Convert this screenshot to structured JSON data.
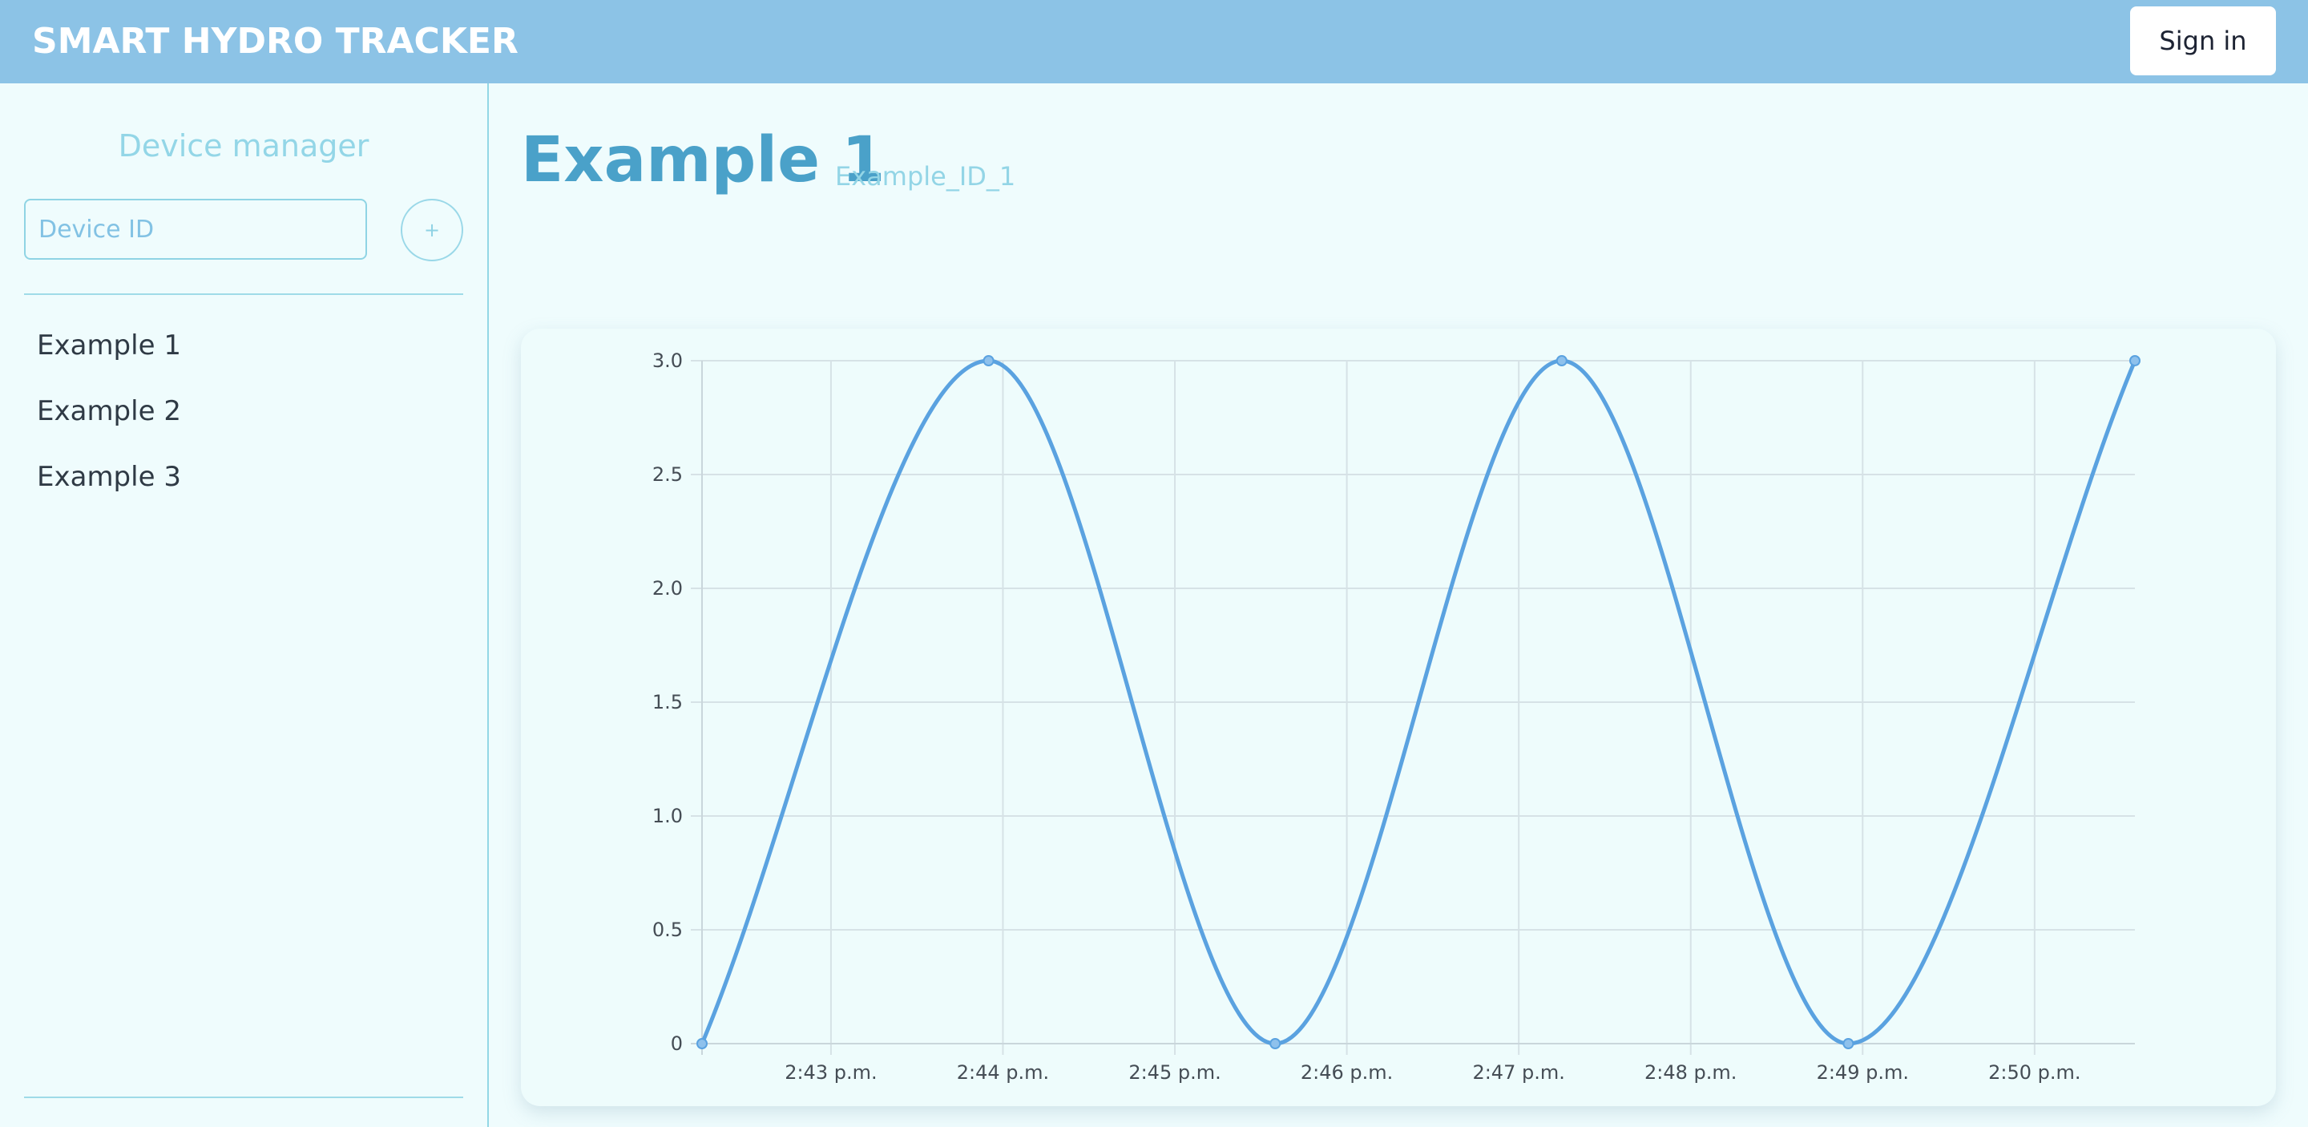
{
  "header": {
    "brand": "SMART HYDRO TRACKER",
    "signin_label": "Sign in",
    "background": "#8cc3e6"
  },
  "sidebar": {
    "title": "Device manager",
    "device_input_placeholder": "Device ID",
    "add_label": "+",
    "devices": [
      "Example 1",
      "Example 2",
      "Example 3"
    ]
  },
  "main": {
    "title": "Example 1",
    "device_id": "Example_ID_1"
  },
  "chart_data": {
    "type": "line",
    "xlabel": "",
    "ylabel": "",
    "ylim": [
      0,
      3
    ],
    "xlim": [
      "2:42:15 p.m.",
      "2:50:35 p.m."
    ],
    "y_ticks": [
      "0",
      "0.5",
      "1.0",
      "1.5",
      "2.0",
      "2.5",
      "3.0"
    ],
    "x_ticks": [
      "2:43 p.m.",
      "2:44 p.m.",
      "2:45 p.m.",
      "2:46 p.m.",
      "2:47 p.m.",
      "2:48 p.m.",
      "2:49 p.m.",
      "2:50 p.m."
    ],
    "grid": true,
    "legend": "none",
    "line_color": "#5aa2e0",
    "curve": "smooth",
    "series": [
      {
        "x": [
          "2:42:15 p.m.",
          "2:43:55 p.m.",
          "2:45:35 p.m.",
          "2:47:15 p.m.",
          "2:48:55 p.m.",
          "2:50:35 p.m."
        ],
        "values": [
          0,
          3,
          0,
          3,
          0,
          3
        ]
      }
    ]
  }
}
